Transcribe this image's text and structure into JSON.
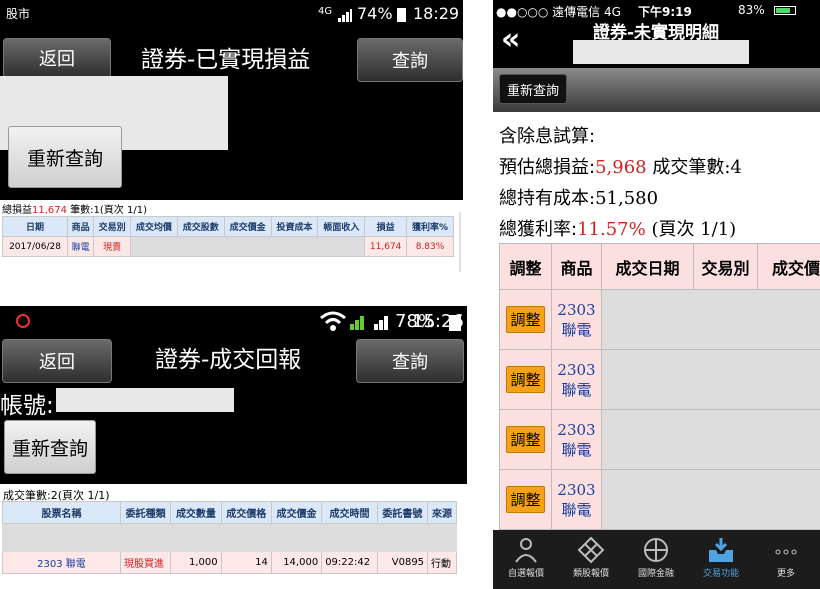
{
  "p1": {
    "status": {
      "carrier": "股市",
      "net": "4G",
      "battery": "74%",
      "time": "18:29"
    },
    "back": "返回",
    "title": "證券-已實現損益",
    "query": "查詢",
    "refresh": "重新查詢",
    "summary_prefix": "總損益",
    "summary_value": "11,674",
    "summary_suffix": " 筆數:1(頁次 1/1)",
    "headers": [
      "日期",
      "商品",
      "交易別",
      "成交均價",
      "成交股數",
      "成交價金",
      "投資成本",
      "帳面收入",
      "損益",
      "獲利率%"
    ],
    "row": {
      "date": "2017/06/28",
      "product": "聯電",
      "type": "現賣",
      "pl": "11,674",
      "rate": "8.83%"
    }
  },
  "p2": {
    "status": {
      "battery": "78%",
      "time": "15:26"
    },
    "back": "返回",
    "title": "證券-成交回報",
    "query": "查詢",
    "account_label": "帳號:",
    "refresh": "重新查詢",
    "summary": "成交筆數:2(頁次 1/1)",
    "headers": [
      "股票名稱",
      "委託種類",
      "成交數量",
      "成交價格",
      "成交價金",
      "成交時間",
      "委託書號",
      "來源"
    ],
    "row": {
      "name": "2303 聯電",
      "kind": "現股買進",
      "qty": "1,000",
      "price": "14",
      "amount": "14,000",
      "time": "09:22:42",
      "order": "V0895",
      "source": "行動"
    }
  },
  "p3": {
    "status": {
      "carrier": "●●○○○ 遠傳電信 4G",
      "time": "下午9:19",
      "battery": "83%"
    },
    "back": "«",
    "title": "證券-未實現明細",
    "refresh": "重新查詢",
    "line1": "含除息試算:",
    "line2_label": "預估總損益:",
    "line2_value": "5,968",
    "line2_suffix": " 成交筆數:4",
    "line3": "總持有成本:51,580",
    "line4_label": "總獲利率:",
    "line4_value": "11.57%",
    "line4_suffix": " (頁次 1/1)",
    "headers": [
      "調整",
      "商品",
      "成交日期",
      "交易別",
      "成交價"
    ],
    "rows": [
      {
        "adj": "調整",
        "code": "2303",
        "name": "聯電"
      },
      {
        "adj": "調整",
        "code": "2303",
        "name": "聯電"
      },
      {
        "adj": "調整",
        "code": "2303",
        "name": "聯電"
      },
      {
        "adj": "調整",
        "code": "2303",
        "name": "聯電"
      }
    ],
    "tabs": [
      "自選報價",
      "類股報價",
      "國際金融",
      "交易功能",
      "更多"
    ],
    "accent": "#4fa3e0"
  }
}
